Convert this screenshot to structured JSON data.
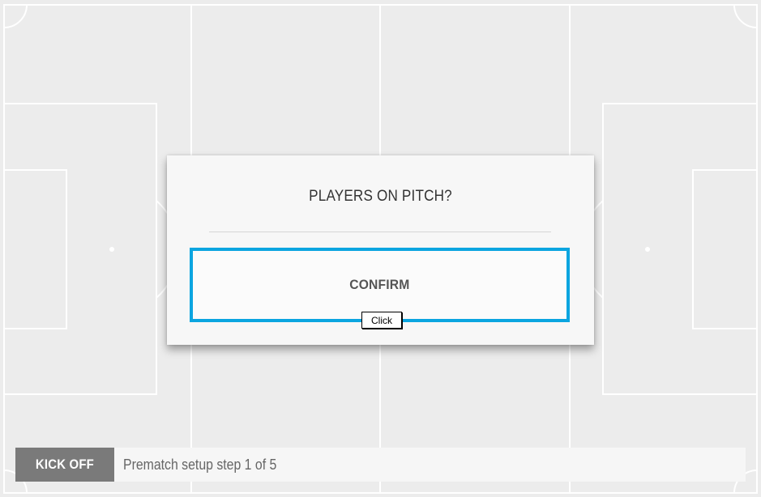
{
  "dialog": {
    "title": "PLAYERS ON PITCH?",
    "confirm_label": "CONFIRM"
  },
  "tooltip": {
    "text": "Click"
  },
  "status_bar": {
    "kickoff_label": "KICK OFF",
    "status_text": "Prematch setup step 1 of 5"
  },
  "colors": {
    "pitch": "#ececec",
    "pitch_lines": "#ffffff",
    "accent": "#0ba5e0",
    "kickoff_button": "#7a7a7a"
  }
}
